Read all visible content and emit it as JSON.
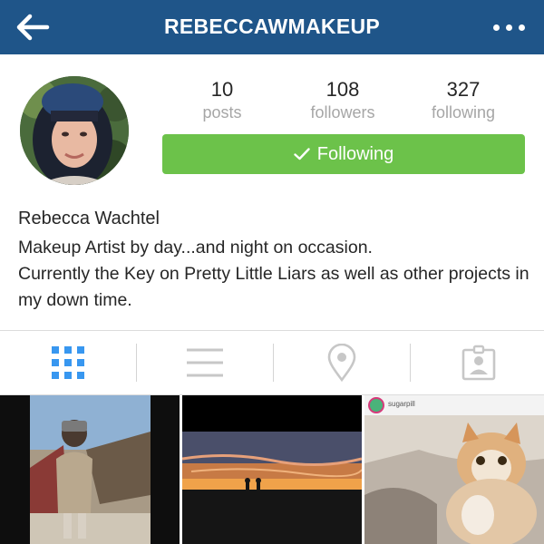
{
  "header": {
    "username": "REBECCAWMAKEUP"
  },
  "profile": {
    "stats": [
      {
        "value": "10",
        "label": "posts"
      },
      {
        "value": "108",
        "label": "followers"
      },
      {
        "value": "327",
        "label": "following"
      }
    ],
    "follow_button_label": "Following",
    "name": "Rebecca Wachtel",
    "bio": "Makeup Artist by day...and night on occasion.\nCurrently the Key on Pretty Little Liars as well as other projects in my down time."
  },
  "tabs": [
    {
      "icon": "grid-icon",
      "active": true
    },
    {
      "icon": "list-icon",
      "active": false
    },
    {
      "icon": "location-pin-icon",
      "active": false
    },
    {
      "icon": "tagged-person-icon",
      "active": false
    }
  ],
  "posts": [
    {
      "id": "post-1"
    },
    {
      "id": "post-2"
    },
    {
      "id": "post-3",
      "overlay_text": "sugarpill"
    }
  ],
  "colors": {
    "topbar": "#1f5589",
    "follow_button": "#6cc24a",
    "active_tab": "#3897f0",
    "inactive_tab": "#c7c7c7"
  }
}
